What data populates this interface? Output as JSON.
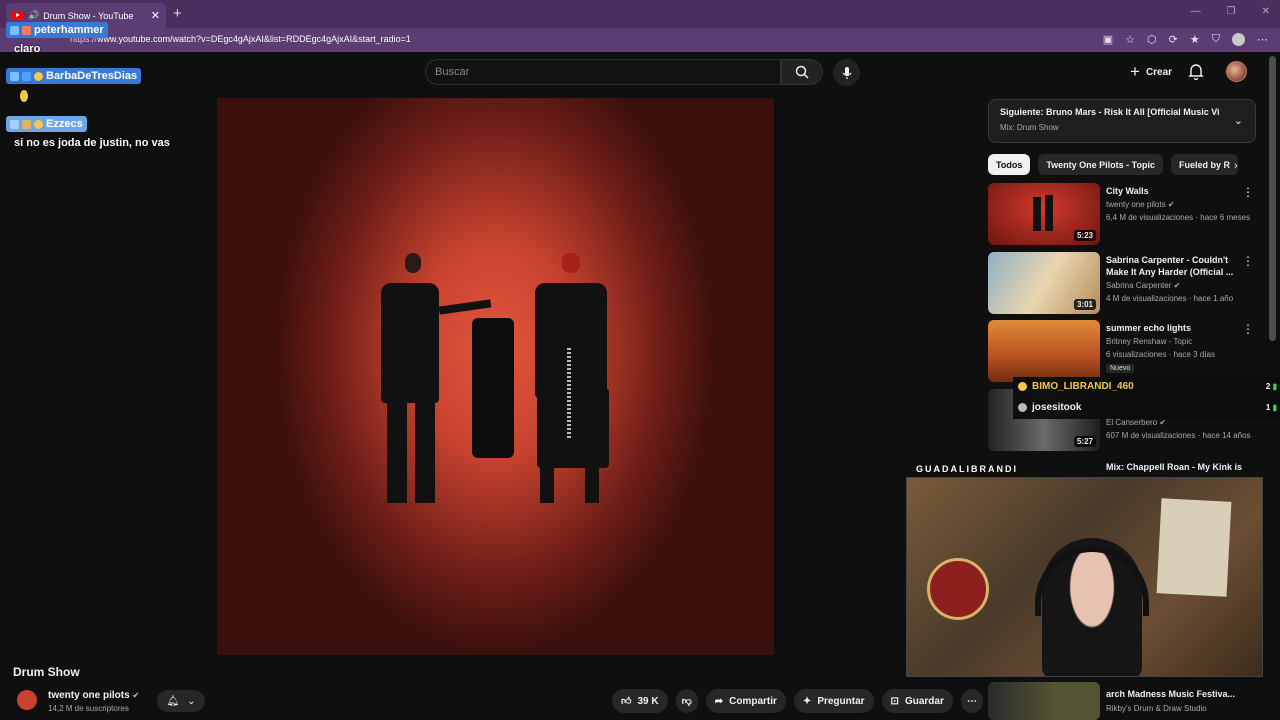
{
  "browser": {
    "tab_title": "Drum Show - YouTube",
    "url_prefix": "https://",
    "url_main": "www.youtube.com/watch?v=DEgc4gAjxAI&list=RDDEgc4gAjxAI&start_radio=1"
  },
  "header": {
    "search_placeholder": "Buscar",
    "create_label": "Crear"
  },
  "video": {
    "title": "Drum Show",
    "channel": "twenty one pilots",
    "subscribers": "14,2 M de suscriptores",
    "likes": "39 K",
    "share": "Compartir",
    "ask": "Preguntar",
    "save": "Guardar"
  },
  "next_up": {
    "prefix": "Siguiente:",
    "title": "Bruno Mars - Risk It All [Official Music Vi...",
    "mix": "Mix: Drum Show"
  },
  "chips": [
    "Todos",
    "Twenty One Pilots - Topic",
    "Fueled by R"
  ],
  "recommendations": [
    {
      "title": "City Walls",
      "channel": "twenty one pilots",
      "meta": "6,4 M de visualizaciones · hace 6 meses",
      "duration": "5:23"
    },
    {
      "title": "Sabrina Carpenter - Couldn't Make It Any Harder (Official ...",
      "channel": "Sabrina Carpenter",
      "meta": "4 M de visualizaciones · hace 1 año",
      "duration": "3:01"
    },
    {
      "title": "summer echo lights",
      "channel": "Britney Renshaw - Topic",
      "meta": "6 visualizaciones · hace 3 días",
      "badge": "Nuevo"
    },
    {
      "title": "",
      "channel": "El Canserbero",
      "meta": "607 M de visualizaciones · hace 14 años",
      "duration": "5:27"
    },
    {
      "title": "arch Madness Music Festiva...",
      "channel": "Rikby's Drum & Draw Studio"
    }
  ],
  "rec_partial": "Mix: Chappell Roan - My Kink is",
  "chat": [
    {
      "user": "peterhammer",
      "message": "claro"
    },
    {
      "user": "BarbaDeTresDias",
      "message": ""
    },
    {
      "user": "Ezzecs",
      "message": "si no es joda de justin, no vas"
    }
  ],
  "viewers": [
    {
      "name": "BIMO_LIBRANDI_460",
      "count": "2"
    },
    {
      "name": "josesitook",
      "count": "1"
    }
  ],
  "streamer_label": "GUADALIBRANDI",
  "colors": {
    "accent": "#ff0000",
    "browser_purple": "#5b3d73",
    "chat_blue": "#3a78d6"
  }
}
